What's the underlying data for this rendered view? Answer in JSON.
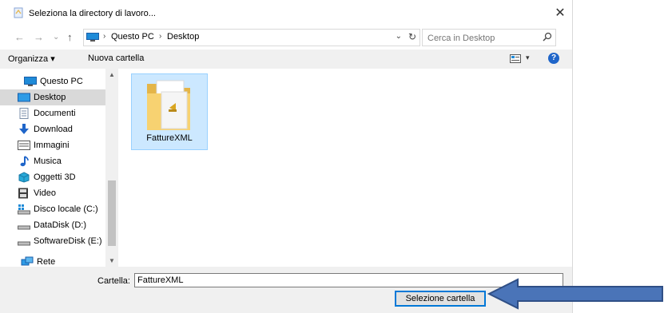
{
  "window": {
    "title": "Seleziona la directory di lavoro...",
    "close_glyph": "✕"
  },
  "nav": {
    "back_glyph": "←",
    "forward_glyph": "→",
    "recent_glyph": "⌄",
    "up_glyph": "↑",
    "breadcrumb": [
      "Questo PC",
      "Desktop"
    ],
    "breadcrumb_sep": "›",
    "dropdown_glyph": "⌄",
    "refresh_glyph": "↻",
    "search_placeholder": "Cerca in Desktop"
  },
  "toolbar": {
    "organize_label": "Organizza ▾",
    "new_folder_label": "Nuova cartella",
    "view_dropdown_glyph": "▾",
    "help_glyph": "?"
  },
  "sidebar": {
    "items": [
      {
        "label": "Questo PC",
        "icon": "computer-icon",
        "selected": false
      },
      {
        "label": "Desktop",
        "icon": "desktop-icon",
        "selected": true
      },
      {
        "label": "Documenti",
        "icon": "documents-icon",
        "selected": false
      },
      {
        "label": "Download",
        "icon": "download-icon",
        "selected": false
      },
      {
        "label": "Immagini",
        "icon": "pictures-icon",
        "selected": false
      },
      {
        "label": "Musica",
        "icon": "music-icon",
        "selected": false
      },
      {
        "label": "Oggetti 3D",
        "icon": "3d-objects-icon",
        "selected": false
      },
      {
        "label": "Video",
        "icon": "video-icon",
        "selected": false
      },
      {
        "label": "Disco locale (C:)",
        "icon": "local-disk-icon",
        "selected": false
      },
      {
        "label": "DataDisk (D:)",
        "icon": "drive-icon",
        "selected": false
      },
      {
        "label": "SoftwareDisk (E:)",
        "icon": "drive-icon",
        "selected": false
      },
      {
        "label": "Rete",
        "icon": "network-icon",
        "selected": false
      }
    ],
    "scroll_up_glyph": "▲",
    "scroll_down_glyph": "▼"
  },
  "content": {
    "items": [
      {
        "name": "FattureXML",
        "icon": "folder-icon",
        "selected": true
      }
    ]
  },
  "footer": {
    "folder_label": "Cartella:",
    "folder_value": "FattureXML",
    "select_button_label": "Selezione cartella"
  },
  "colors": {
    "selection_bg": "#cce8ff",
    "selection_border": "#99d1ff",
    "accent": "#0078d7",
    "annotation_arrow": "#4a74b8"
  }
}
